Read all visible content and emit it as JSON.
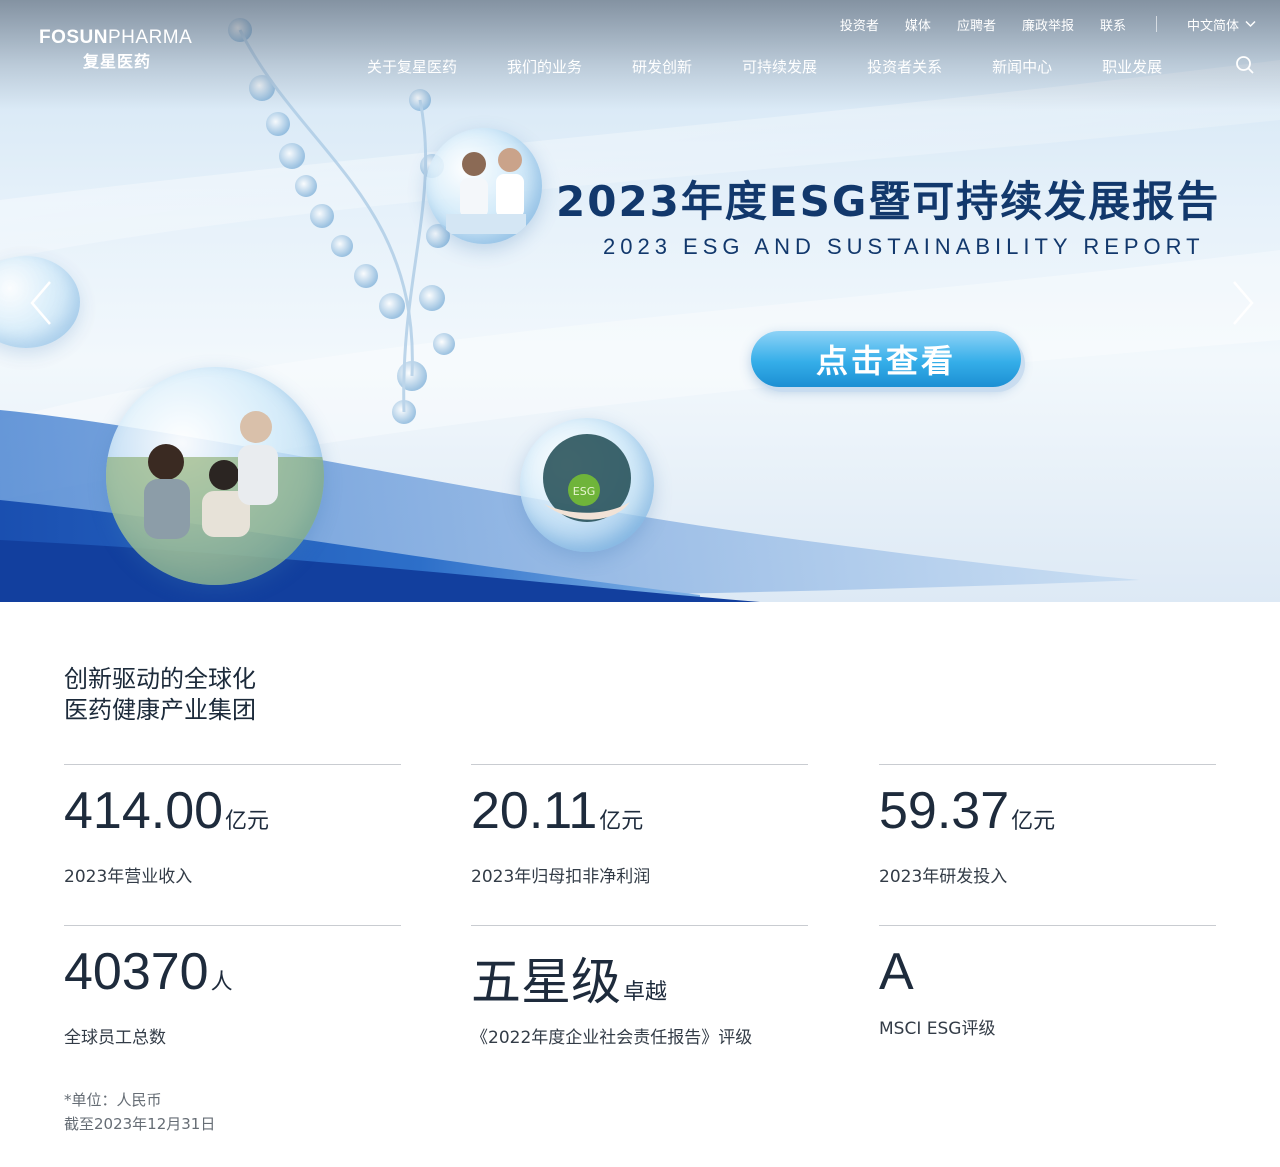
{
  "header": {
    "logo_en_bold": "FOSUN",
    "logo_en_light": "PHARMA",
    "logo_cn": "复星医药",
    "utility_links": [
      "投资者",
      "媒体",
      "应聘者",
      "廉政举报",
      "联系"
    ],
    "language": "中文简体",
    "nav": [
      "关于复星医药",
      "我们的业务",
      "研发创新",
      "可持续发展",
      "投资者关系",
      "新闻中心",
      "职业发展"
    ]
  },
  "hero": {
    "title": "2023年度ESG暨可持续发展报告",
    "subtitle": "2023 ESG AND SUSTAINABILITY REPORT",
    "cta": "点击查看"
  },
  "intro": {
    "line1": "创新驱动的全球化",
    "line2": "医药健康产业集团"
  },
  "stats": [
    {
      "value": "414.00",
      "unit": "亿元",
      "label": "2023年营业收入"
    },
    {
      "value": "20.11",
      "unit": "亿元",
      "label": "2023年归母扣非净利润"
    },
    {
      "value": "59.37",
      "unit": "亿元",
      "label": "2023年研发投入"
    },
    {
      "value": "40370",
      "unit": "人",
      "label": "全球员工总数"
    },
    {
      "value": "五星级",
      "unit": "卓越",
      "label": "《2022年度企业社会责任报告》评级"
    },
    {
      "value": "A",
      "unit": "",
      "label": "MSCI ESG评级"
    }
  ],
  "footnote": {
    "line1": "*单位：人民币",
    "line2": "截至2023年12月31日"
  },
  "colors": {
    "brand_navy": "#12386c",
    "cta_blue": "#35aee9",
    "text_dark": "#1e2b3c"
  }
}
